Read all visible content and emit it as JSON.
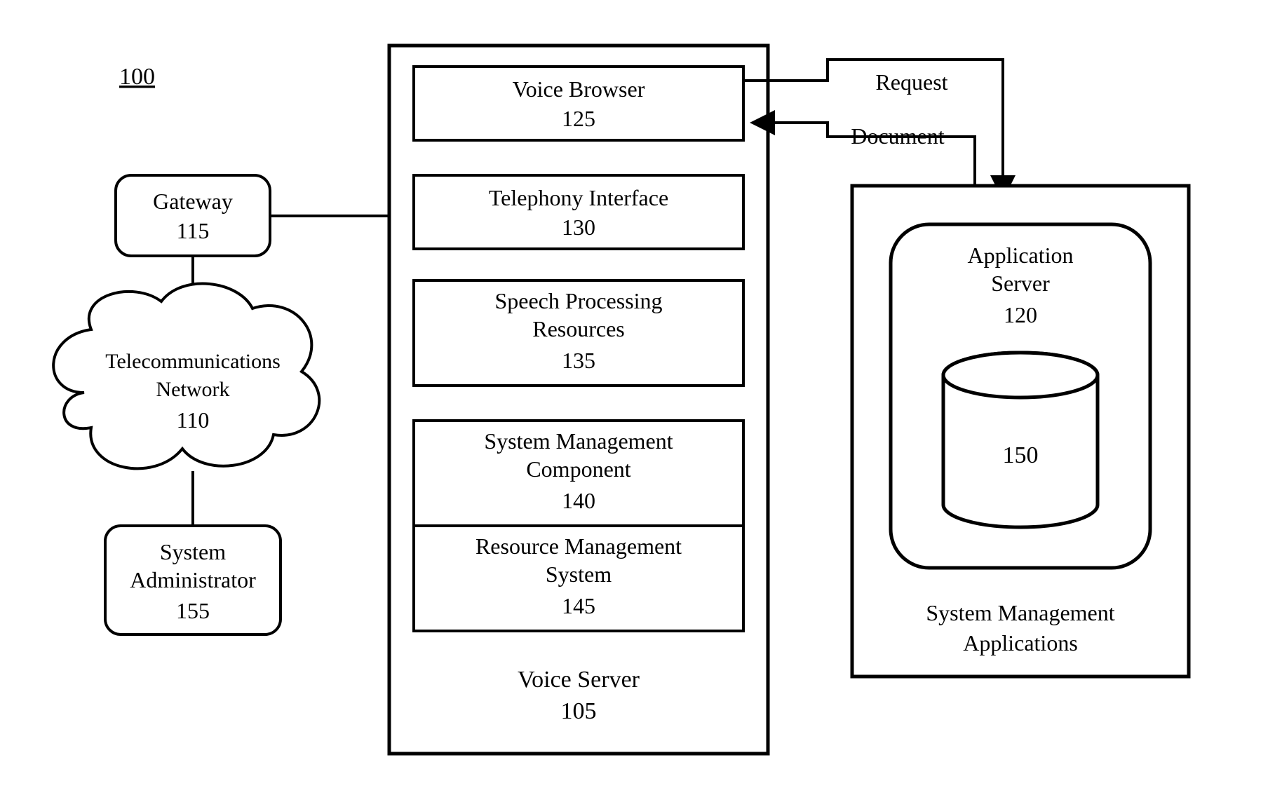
{
  "figure_ref": "100",
  "gateway": {
    "label": "Gateway",
    "num": "115"
  },
  "telecom": {
    "l1": "Telecommunications",
    "l2": "Network",
    "num": "110"
  },
  "sysadmin": {
    "l1": "System",
    "l2": "Administrator",
    "num": "155"
  },
  "voice_server": {
    "title": "Voice Server",
    "num": "105",
    "voice_browser": {
      "label": "Voice Browser",
      "num": "125"
    },
    "telephony": {
      "label": "Telephony Interface",
      "num": "130"
    },
    "speech": {
      "l1": "Speech Processing",
      "l2": "Resources",
      "num": "135"
    },
    "sysmgmt": {
      "l1": "System Management",
      "l2": "Component",
      "num": "140"
    },
    "resmgmt": {
      "l1": "Resource Management",
      "l2": "System",
      "num": "145"
    }
  },
  "right_panel": {
    "request_label": "Request",
    "document_label": "Document",
    "appserver": {
      "l1": "Application",
      "l2": "Server",
      "num": "120"
    },
    "db_num": "150",
    "caption_l1": "System Management",
    "caption_l2": "Applications"
  }
}
